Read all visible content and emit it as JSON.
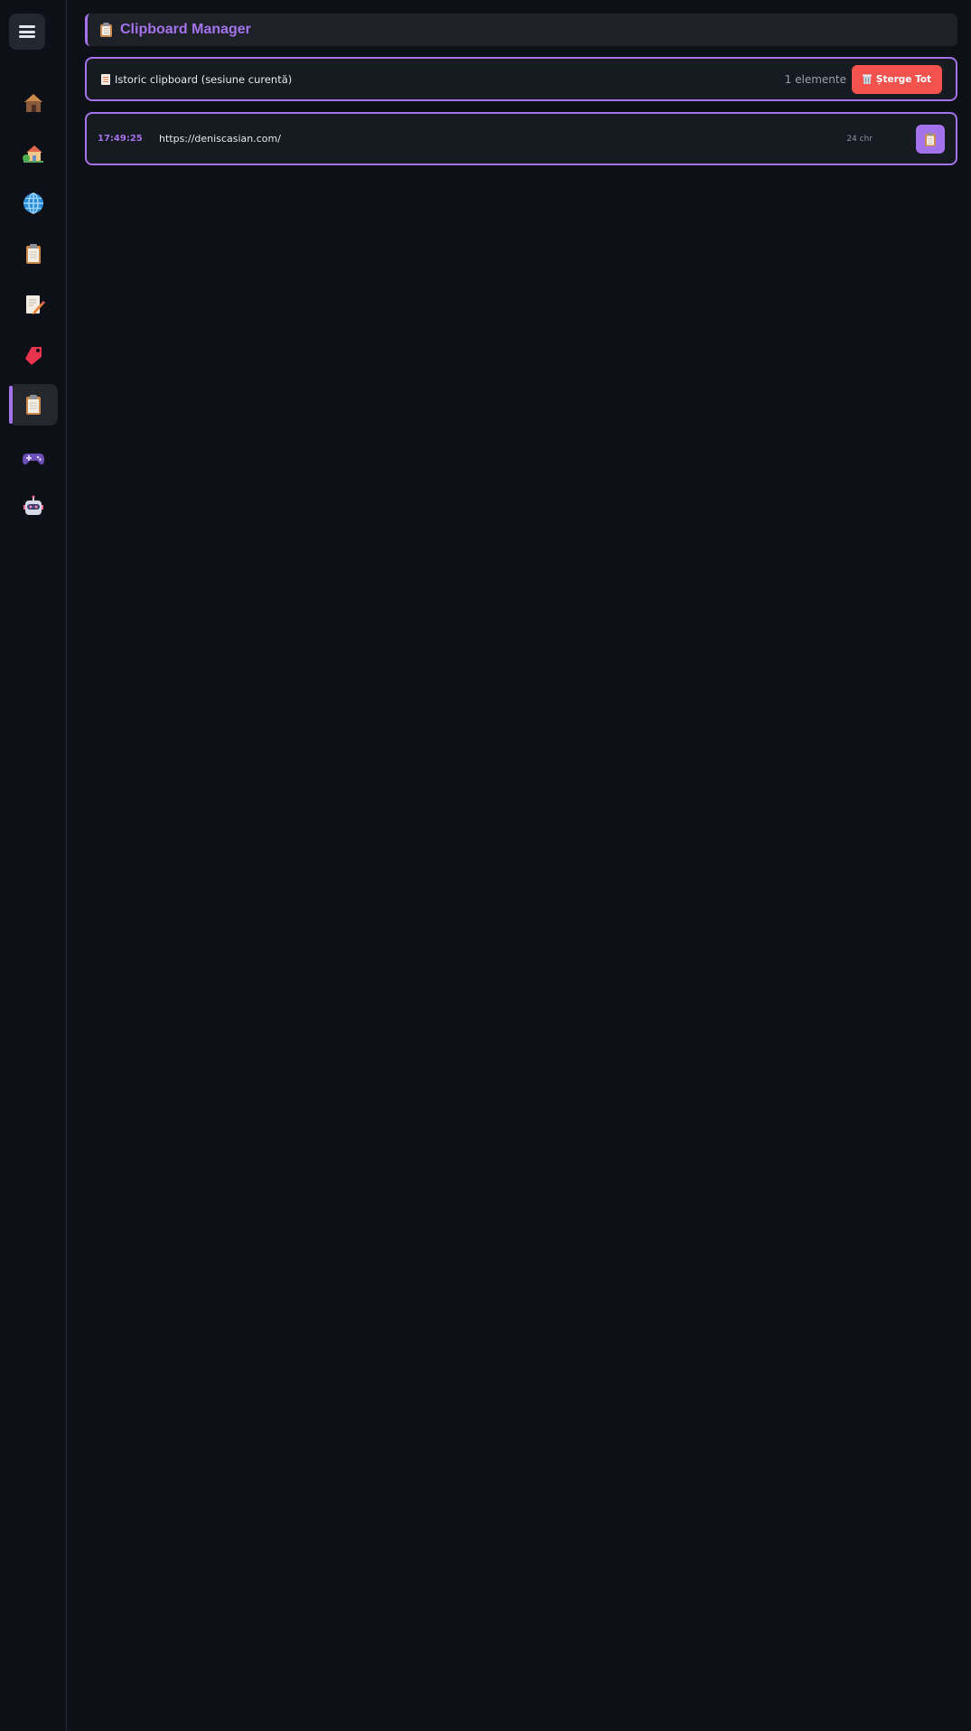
{
  "sidebar": {
    "menu_icon": "hamburger-icon",
    "items": [
      {
        "icon": "house-icon",
        "active": false
      },
      {
        "icon": "house-with-garden-icon",
        "active": false
      },
      {
        "icon": "globe-icon",
        "active": false
      },
      {
        "icon": "clipboard-icon",
        "active": false
      },
      {
        "icon": "memo-icon",
        "active": false
      },
      {
        "icon": "bookmark-tag-icon",
        "active": false
      },
      {
        "icon": "clipboard-icon",
        "active": true
      },
      {
        "icon": "game-controller-icon",
        "active": false
      },
      {
        "icon": "robot-icon",
        "active": false
      }
    ]
  },
  "header": {
    "icon": "clipboard-icon",
    "title": "Clipboard Manager"
  },
  "history": {
    "icon": "page-icon",
    "label": "Istoric clipboard (sesiune curentă)",
    "count": "1 elemente",
    "clear_icon": "wastebasket-icon",
    "clear_label": "Șterge Tot"
  },
  "entries": [
    {
      "time": "17:49:25",
      "text": "https://deniscasian.com/",
      "size": "24 chr",
      "copy_icon": "copy-icon"
    }
  ],
  "colors": {
    "accent": "#a472ea",
    "danger": "#f4534d",
    "background": "#0d1017",
    "surface": "#161a21"
  }
}
